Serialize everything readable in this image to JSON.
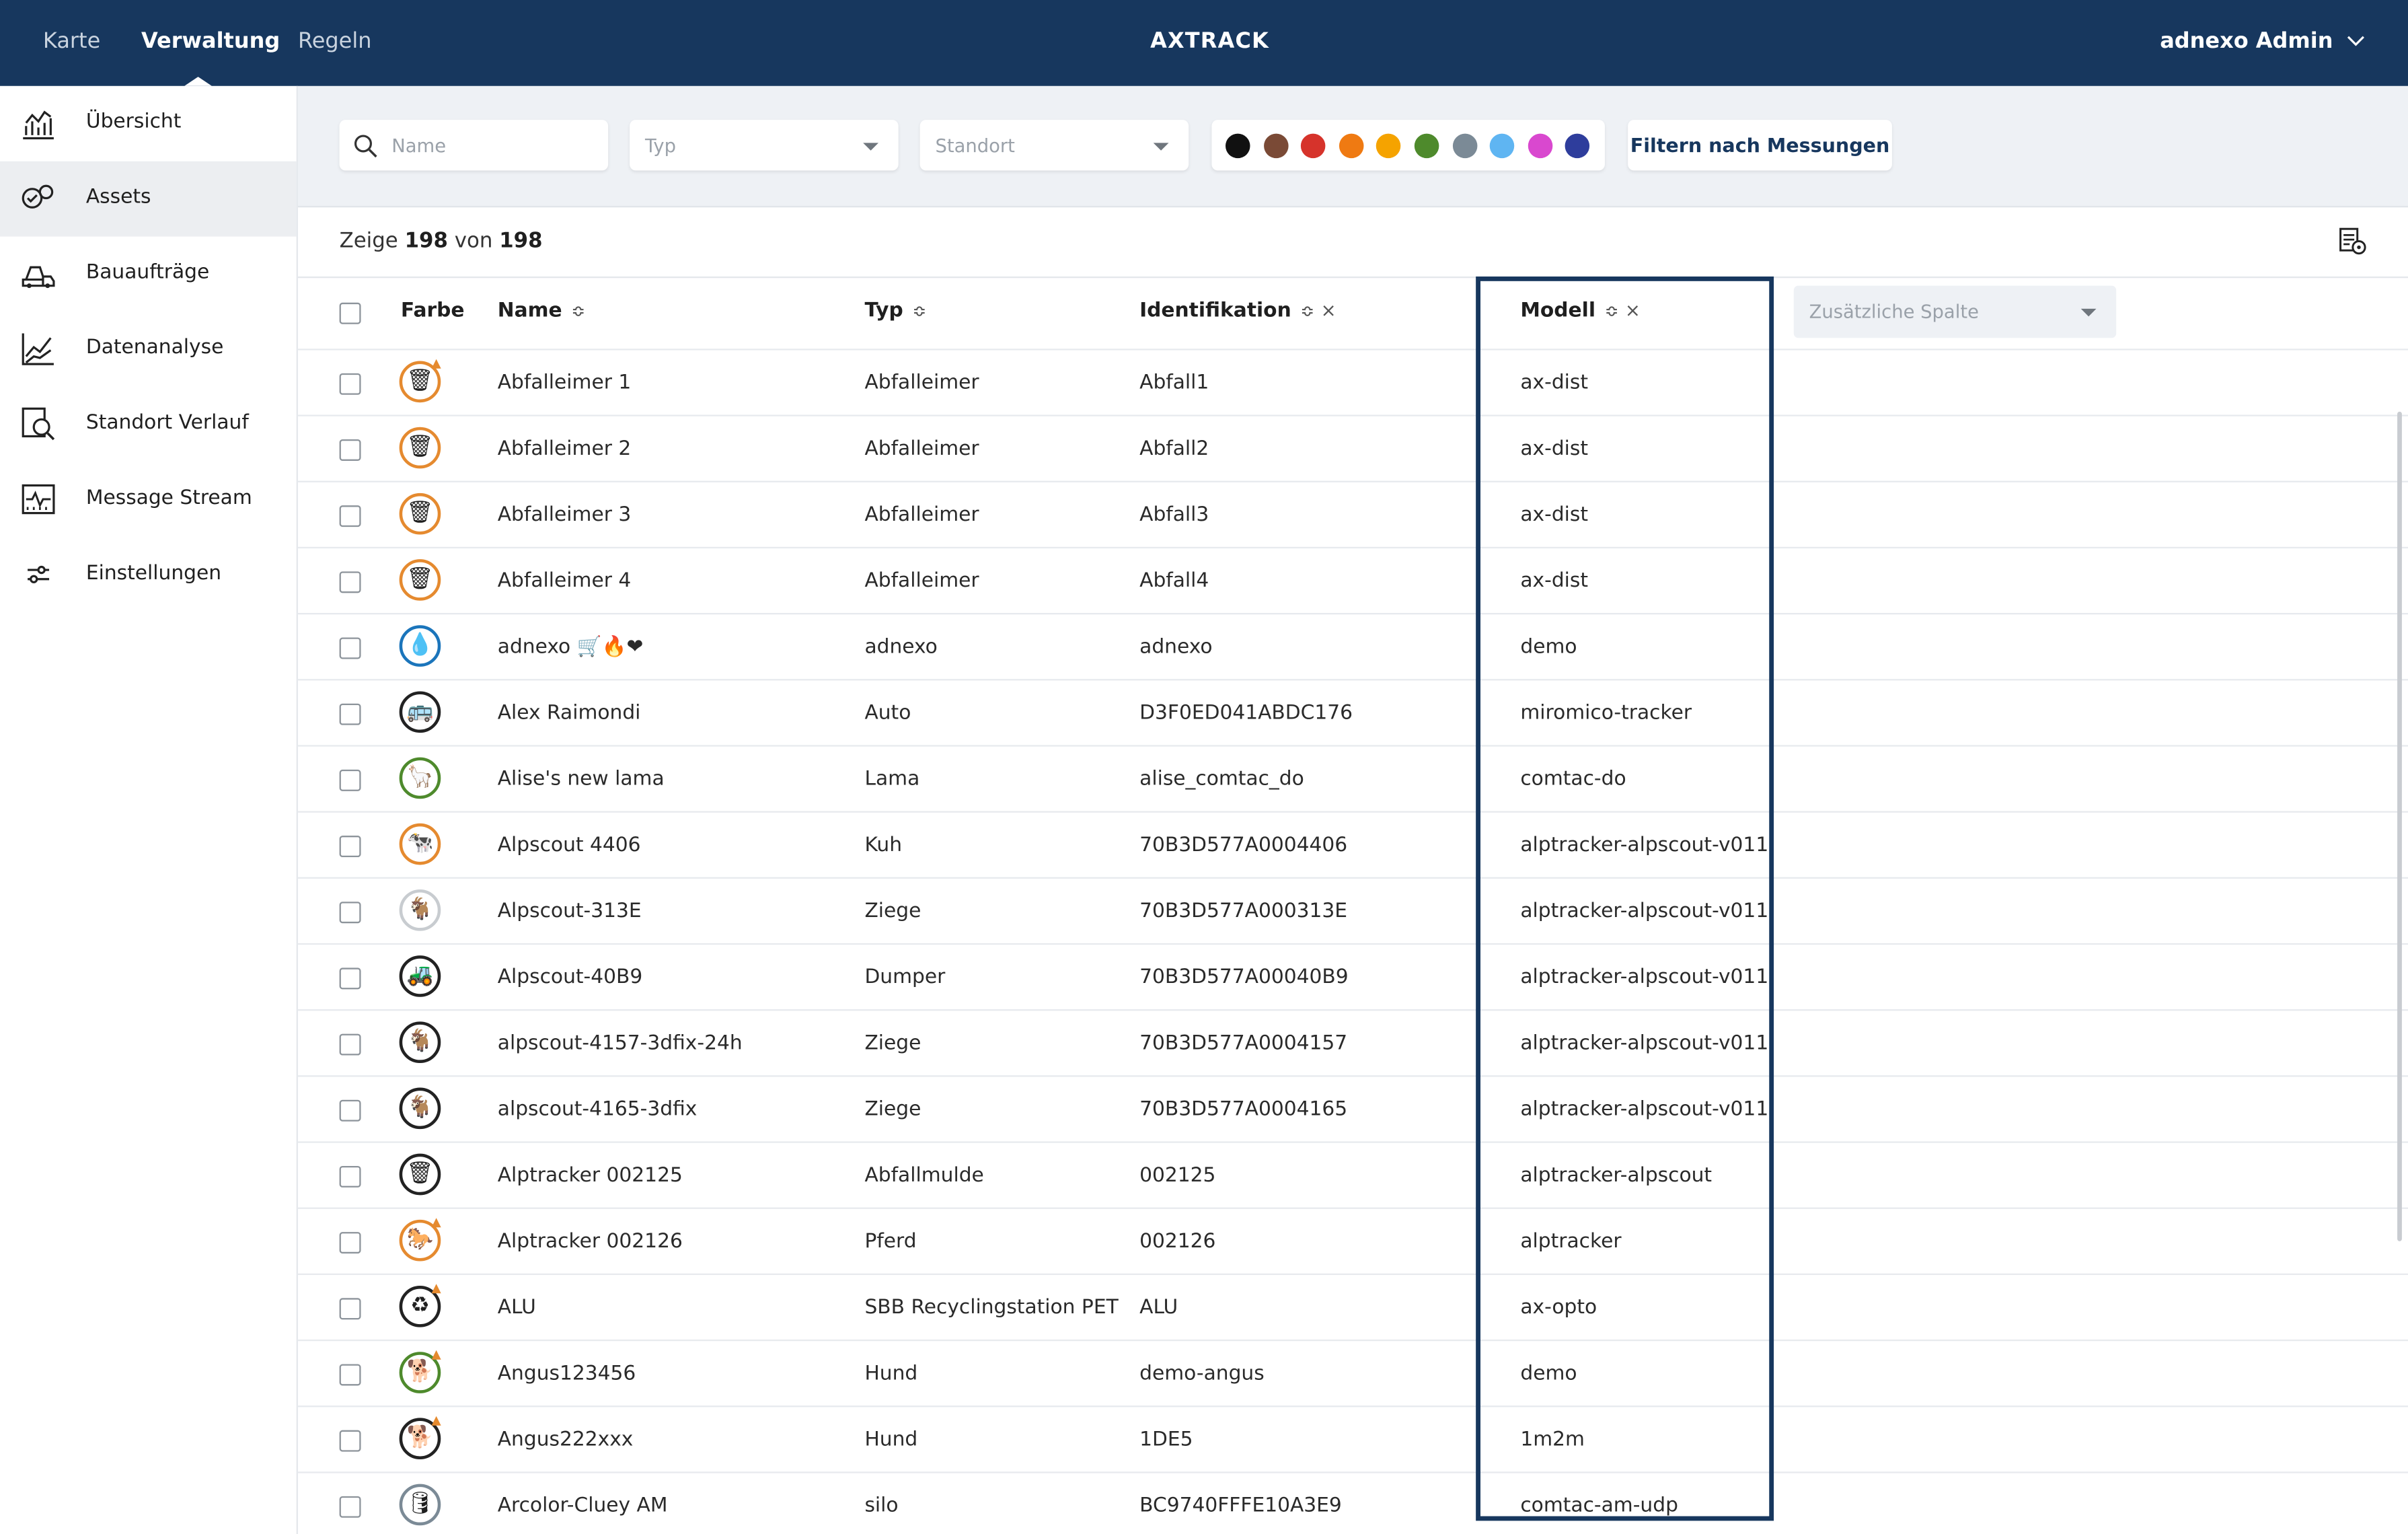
{
  "topnav": {
    "items": [
      "Karte",
      "Verwaltung",
      "Regeln"
    ],
    "active": "Verwaltung",
    "logo": "AXTRACK",
    "user": "adnexo Admin"
  },
  "sidebar": {
    "items": [
      {
        "label": "Übersicht",
        "icon": "overview-chart-icon"
      },
      {
        "label": "Assets",
        "icon": "assets-icon",
        "active": true
      },
      {
        "label": "Bauaufträge",
        "icon": "construction-orders-icon"
      },
      {
        "label": "Datenanalyse",
        "icon": "data-analysis-icon"
      },
      {
        "label": "Standort Verlauf",
        "icon": "location-history-icon"
      },
      {
        "label": "Message Stream",
        "icon": "message-stream-icon"
      },
      {
        "label": "Einstellungen",
        "icon": "settings-sliders-icon"
      }
    ]
  },
  "filters": {
    "name_placeholder": "Name",
    "type_placeholder": "Typ",
    "location_placeholder": "Standort",
    "colors": [
      "#111111",
      "#7a4a36",
      "#d6332b",
      "#ef7a12",
      "#f5a300",
      "#4e8a2c",
      "#7b8a96",
      "#5fb5f2",
      "#d948cf",
      "#2e3d9c"
    ],
    "measure_button": "Filtern nach Messungen"
  },
  "count": {
    "prefix": "Zeige",
    "shown": "198",
    "sep": "von",
    "total": "198"
  },
  "table": {
    "headers": {
      "color": "Farbe",
      "name": "Name",
      "type": "Typ",
      "identification": "Identifikation",
      "model": "Modell",
      "extra_placeholder": "Zusätzliche Spalte"
    },
    "rows": [
      {
        "name": "Abfalleimer 1",
        "type": "Abfalleimer",
        "id": "Abfall1",
        "model": "ax-dist",
        "icon": "🗑",
        "ring": "#e58a2f",
        "warn": true
      },
      {
        "name": "Abfalleimer 2",
        "type": "Abfalleimer",
        "id": "Abfall2",
        "model": "ax-dist",
        "icon": "🗑",
        "ring": "#e58a2f",
        "warn": false
      },
      {
        "name": "Abfalleimer 3",
        "type": "Abfalleimer",
        "id": "Abfall3",
        "model": "ax-dist",
        "icon": "🗑",
        "ring": "#e58a2f",
        "warn": false
      },
      {
        "name": "Abfalleimer 4",
        "type": "Abfalleimer",
        "id": "Abfall4",
        "model": "ax-dist",
        "icon": "🗑",
        "ring": "#e58a2f",
        "warn": false
      },
      {
        "name": "adnexo 🛒🔥❤",
        "type": "adnexo",
        "id": "adnexo",
        "model": "demo",
        "icon": "💧",
        "ring": "#1b75bb",
        "warn": false
      },
      {
        "name": "Alex Raimondi",
        "type": "Auto",
        "id": "D3F0ED041ABDC176",
        "model": "miromico-tracker",
        "icon": "🚌",
        "ring": "#222222",
        "warn": false
      },
      {
        "name": "Alise's new lama",
        "type": "Lama",
        "id": "alise_comtac_do",
        "model": "comtac-do",
        "icon": "🦙",
        "ring": "#4e8a2c",
        "warn": false
      },
      {
        "name": "Alpscout 4406",
        "type": "Kuh",
        "id": "70B3D577A0004406",
        "model": "alptracker-alpscout-v011",
        "icon": "🐄",
        "ring": "#e58a2f",
        "warn": false
      },
      {
        "name": "Alpscout-313E",
        "type": "Ziege",
        "id": "70B3D577A000313E",
        "model": "alptracker-alpscout-v011",
        "icon": "🐐",
        "ring": "#c8ccd0",
        "warn": false
      },
      {
        "name": "Alpscout-40B9",
        "type": "Dumper",
        "id": "70B3D577A00040B9",
        "model": "alptracker-alpscout-v011",
        "icon": "🚜",
        "ring": "#222222",
        "warn": false
      },
      {
        "name": "alpscout-4157-3dfix-24h",
        "type": "Ziege",
        "id": "70B3D577A0004157",
        "model": "alptracker-alpscout-v011",
        "icon": "🐐",
        "ring": "#222222",
        "warn": false
      },
      {
        "name": "alpscout-4165-3dfix",
        "type": "Ziege",
        "id": "70B3D577A0004165",
        "model": "alptracker-alpscout-v011",
        "icon": "🐐",
        "ring": "#222222",
        "warn": false
      },
      {
        "name": "Alptracker 002125",
        "type": "Abfallmulde",
        "id": "002125",
        "model": "alptracker-alpscout",
        "icon": "🗑",
        "ring": "#222222",
        "warn": false
      },
      {
        "name": "Alptracker 002126",
        "type": "Pferd",
        "id": "002126",
        "model": "alptracker",
        "icon": "🐎",
        "ring": "#e58a2f",
        "warn": true
      },
      {
        "name": "ALU",
        "type": "SBB Recyclingstation PET",
        "id": "ALU",
        "model": "ax-opto",
        "icon": "♻",
        "ring": "#222222",
        "warn": true
      },
      {
        "name": "Angus123456",
        "type": "Hund",
        "id": "demo-angus",
        "model": "demo",
        "icon": "🐕",
        "ring": "#4e8a2c",
        "warn": true
      },
      {
        "name": "Angus222xxx",
        "type": "Hund",
        "id": "1DE5",
        "model": "1m2m",
        "icon": "🐕",
        "ring": "#222222",
        "warn": true
      },
      {
        "name": "Arcolor-Cluey AM",
        "type": "silo",
        "id": "BC9740FFFE10A3E9",
        "model": "comtac-am-udp",
        "icon": "🛢",
        "ring": "#7b8a96",
        "warn": false
      }
    ]
  }
}
